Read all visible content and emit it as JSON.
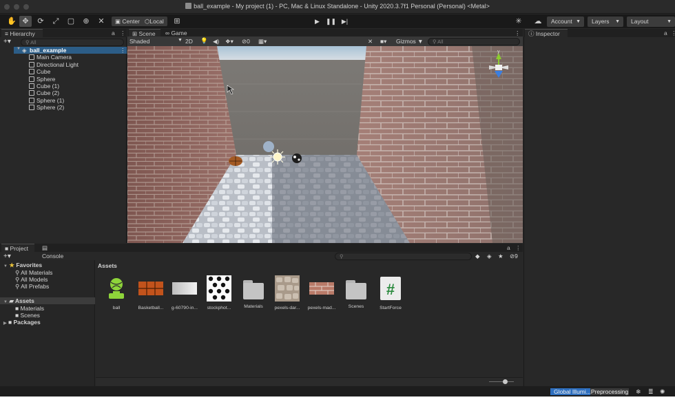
{
  "window": {
    "title": "ball_example - My project (1) - PC, Mac & Linux Standalone - Unity 2020.3.7f1 Personal (Personal) <Metal>"
  },
  "toolbar": {
    "pivot_label": "Center",
    "space_label": "Local",
    "account_label": "Account",
    "layers_label": "Layers",
    "layout_label": "Layout"
  },
  "hierarchy": {
    "tab_label": "Hierarchy",
    "search_placeholder": "All",
    "scene_name": "ball_example",
    "items": [
      {
        "label": "Main Camera"
      },
      {
        "label": "Directional Light"
      },
      {
        "label": "Cube"
      },
      {
        "label": "Sphere"
      },
      {
        "label": "Cube (1)"
      },
      {
        "label": "Cube (2)"
      },
      {
        "label": "Sphere (1)"
      },
      {
        "label": "Sphere (2)"
      }
    ]
  },
  "scene": {
    "tab_scene": "Scene",
    "tab_game": "Game",
    "shading_mode": "Shaded",
    "mode_2d": "2D",
    "hidden_count": "0",
    "gizmos_label": "Gizmos",
    "search_placeholder": "All"
  },
  "inspector": {
    "tab_label": "Inspector"
  },
  "project": {
    "tab_project": "Project",
    "tab_console": "Console",
    "favorites_label": "Favorites",
    "favorites": [
      {
        "label": "All Materials"
      },
      {
        "label": "All Models"
      },
      {
        "label": "All Prefabs"
      }
    ],
    "assets_label": "Assets",
    "assets_children": [
      {
        "label": "Materials"
      },
      {
        "label": "Scenes"
      }
    ],
    "packages_label": "Packages",
    "breadcrumb": "Assets",
    "hidden_packages_count": "9",
    "assets": [
      {
        "label": "ball",
        "icon": "ball-prefab-icon"
      },
      {
        "label": "Basketball...",
        "icon": "basketball-texture-icon"
      },
      {
        "label": "g-60790-in...",
        "icon": "white-texture-icon"
      },
      {
        "label": "stockphot...",
        "icon": "polka-dot-texture-icon"
      },
      {
        "label": "Materials",
        "icon": "folder-icon"
      },
      {
        "label": "pexels-dar...",
        "icon": "stone-texture-icon"
      },
      {
        "label": "pexels-mad...",
        "icon": "brick-texture-icon"
      },
      {
        "label": "Scenes",
        "icon": "folder-icon"
      },
      {
        "label": "StartForce",
        "icon": "csharp-script-icon"
      }
    ]
  },
  "status": {
    "progress_label": "Global Illumi...Preprocessing"
  }
}
